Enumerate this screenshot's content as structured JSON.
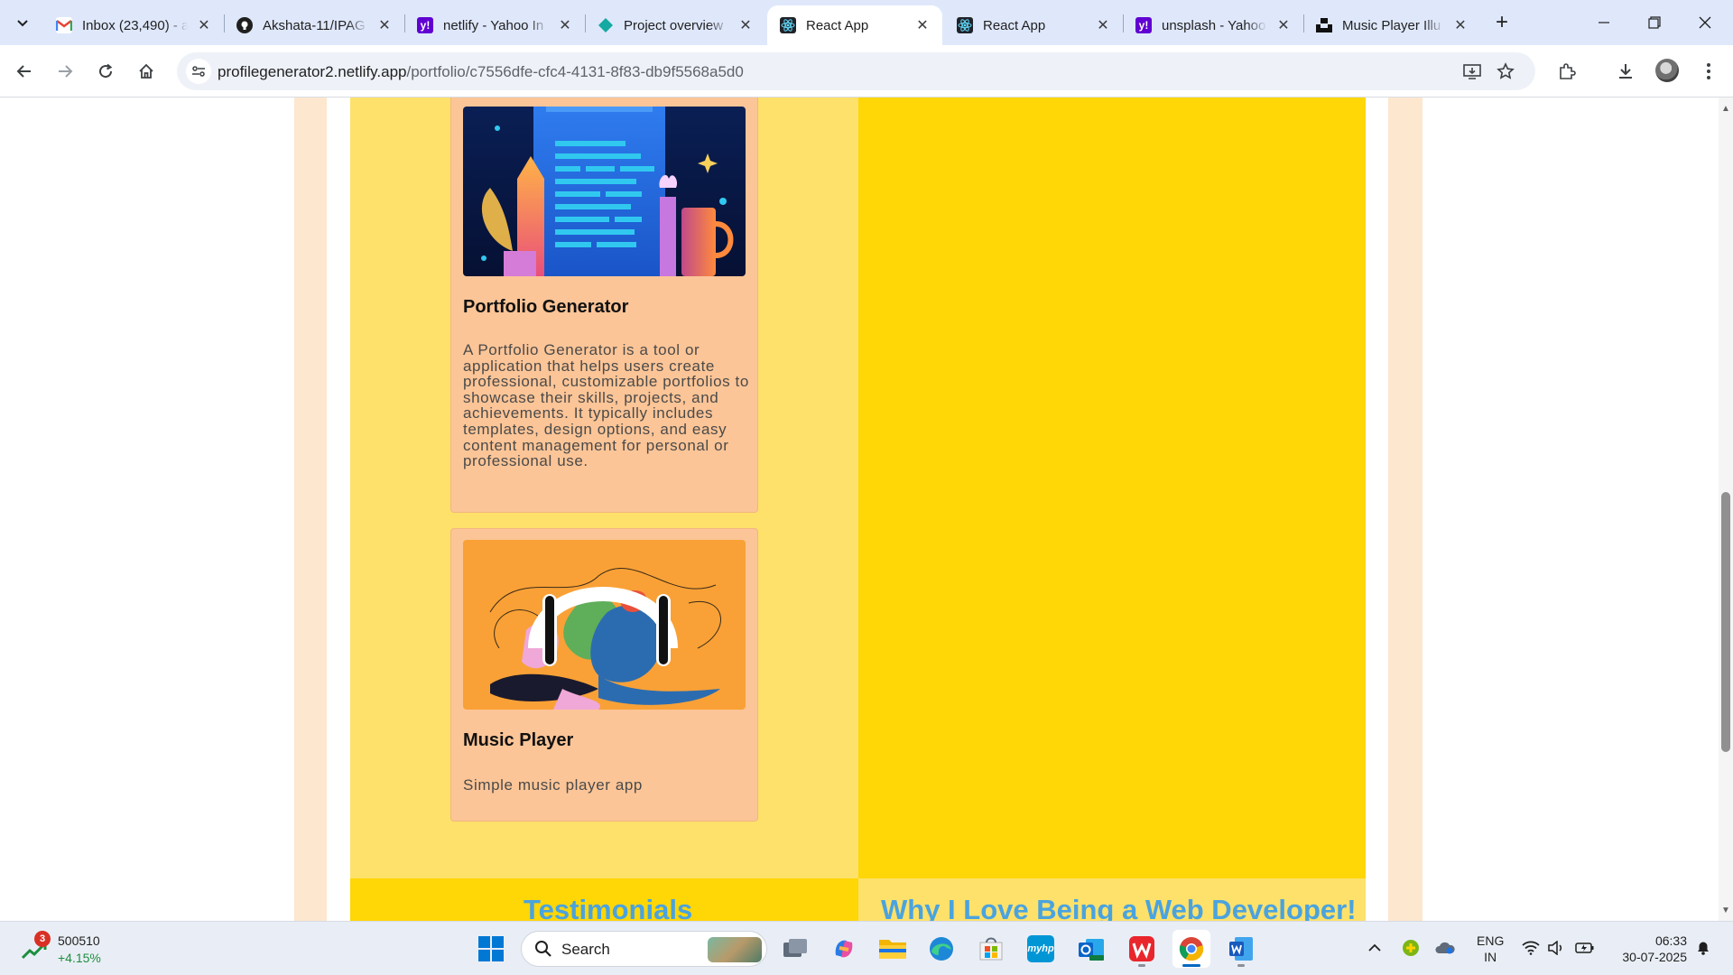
{
  "browser": {
    "tabs": [
      {
        "title": "Inbox (23,490) - a",
        "favicon": "gmail-icon",
        "active": false
      },
      {
        "title": "Akshata-11/IPAG",
        "favicon": "github-icon",
        "active": false
      },
      {
        "title": "netlify - Yahoo In",
        "favicon": "yahoo-icon",
        "active": false
      },
      {
        "title": "Project overview",
        "favicon": "netlify-icon",
        "active": false
      },
      {
        "title": "React App",
        "favicon": "react-icon",
        "active": true
      },
      {
        "title": "React App",
        "favicon": "react-icon",
        "active": false
      },
      {
        "title": "unsplash - Yahoo",
        "favicon": "yahoo-icon",
        "active": false
      },
      {
        "title": "Music Player Illu",
        "favicon": "unsplash-icon",
        "active": false
      }
    ],
    "url_host": "profilegenerator2.netlify.app",
    "url_path": "/portfolio/c7556dfe-cfc4-4131-8f83-db9f5568a5d0"
  },
  "page": {
    "projects": [
      {
        "title": "Portfolio Generator",
        "description": "A Portfolio Generator is a tool or application that helps users create professional, customizable portfolios to showcase their skills, projects, and achievements. It typically includes templates, design options, and easy content management for personal or professional use."
      },
      {
        "title": "Music Player",
        "description": "Simple music player app"
      }
    ],
    "section_left": "Testimonials",
    "section_right": "Why I Love Being a Web Developer!",
    "colors": {
      "band": "#fde7cf",
      "left_column": "#fde16a",
      "right_column": "#ffd606",
      "card": "#fcc597",
      "heading": "#4aa3df"
    }
  },
  "taskbar": {
    "stock_badge": "3",
    "stock_value": "500510",
    "stock_change": "+4.15%",
    "search_label": "Search",
    "lang_line1": "ENG",
    "lang_line2": "IN",
    "time": "06:33",
    "date": "30-07-2025"
  }
}
